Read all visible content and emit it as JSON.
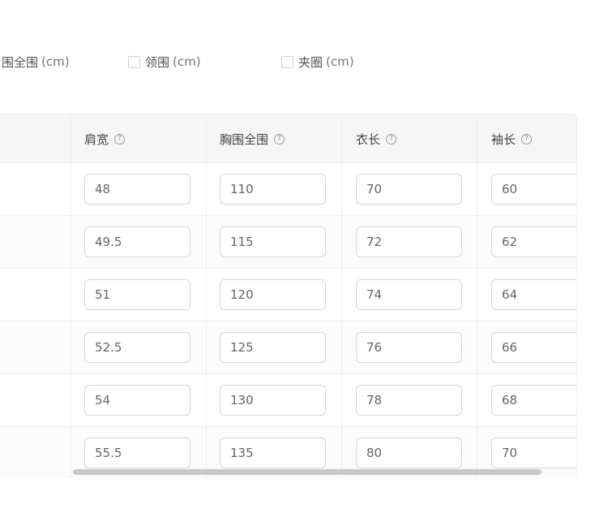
{
  "options": [
    {
      "label": "围全围",
      "unit": "(cm)",
      "has_checkbox": false
    },
    {
      "label": "领围",
      "unit": "(cm)",
      "has_checkbox": true
    },
    {
      "label": "夹圈",
      "unit": "(cm)",
      "has_checkbox": true
    }
  ],
  "table": {
    "headers": [
      "肩宽",
      "胸围全围",
      "衣长",
      "袖长"
    ],
    "help_glyph": "?",
    "rows": [
      [
        "48",
        "110",
        "70",
        "60"
      ],
      [
        "49.5",
        "115",
        "72",
        "62"
      ],
      [
        "51",
        "120",
        "74",
        "64"
      ],
      [
        "52.5",
        "125",
        "76",
        "66"
      ],
      [
        "54",
        "130",
        "78",
        "68"
      ],
      [
        "55.5",
        "135",
        "80",
        "70"
      ]
    ]
  },
  "colors": {
    "header_bg": "#f6f6f6",
    "input_border": "#d6d6d6",
    "scrollbar": "#c8c8c8"
  }
}
